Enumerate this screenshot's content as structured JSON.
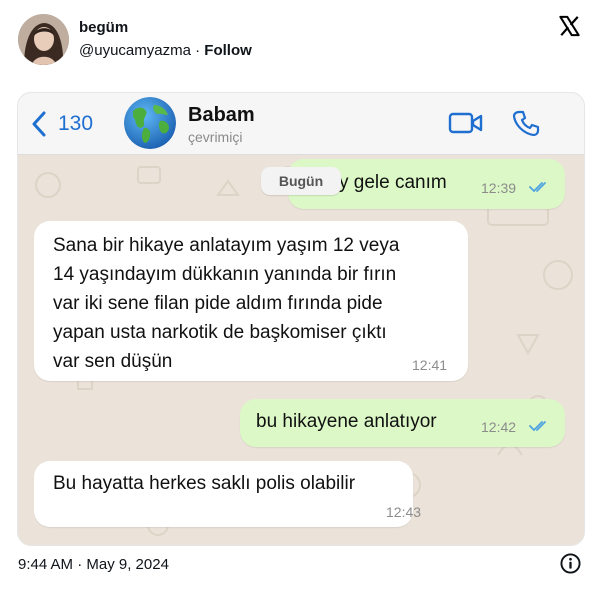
{
  "tweet": {
    "display_name": "begüm",
    "handle": "@uyucamyazma",
    "separator": " · ",
    "follow_label": "Follow",
    "timestamp": "9:44 AM · May 9, 2024",
    "logo_icon": "x-logo-icon",
    "info_icon": "info-icon"
  },
  "chat": {
    "back_count": "130",
    "contact_name": "Babam",
    "contact_status": "çevrimiçi",
    "date_pill": "Bugün",
    "accent_color": "#1f6fd1",
    "outgoing_color": "#dcf8c6",
    "incoming_color": "#ffffff",
    "tick_color": "#4fa3e0",
    "messages": [
      {
        "direction": "out",
        "lines": [
          "y gele canım"
        ],
        "time": "12:39",
        "read": true
      },
      {
        "direction": "in",
        "lines": [
          "Sana bir hikaye anlatayım yaşım 12 veya",
          "14 yaşındayım dükkanın yanında bir fırın",
          "var iki sene filan pide aldım fırında pide",
          "yapan usta narkotik de başkomiser çıktı",
          "var sen düşün"
        ],
        "time": "12:41"
      },
      {
        "direction": "out",
        "lines": [
          "bu hikayene anlatıyor"
        ],
        "time": "12:42",
        "read": true
      },
      {
        "direction": "in",
        "lines": [
          "Bu hayatta herkes saklı polis olabilir"
        ],
        "time": "12:43"
      }
    ]
  }
}
